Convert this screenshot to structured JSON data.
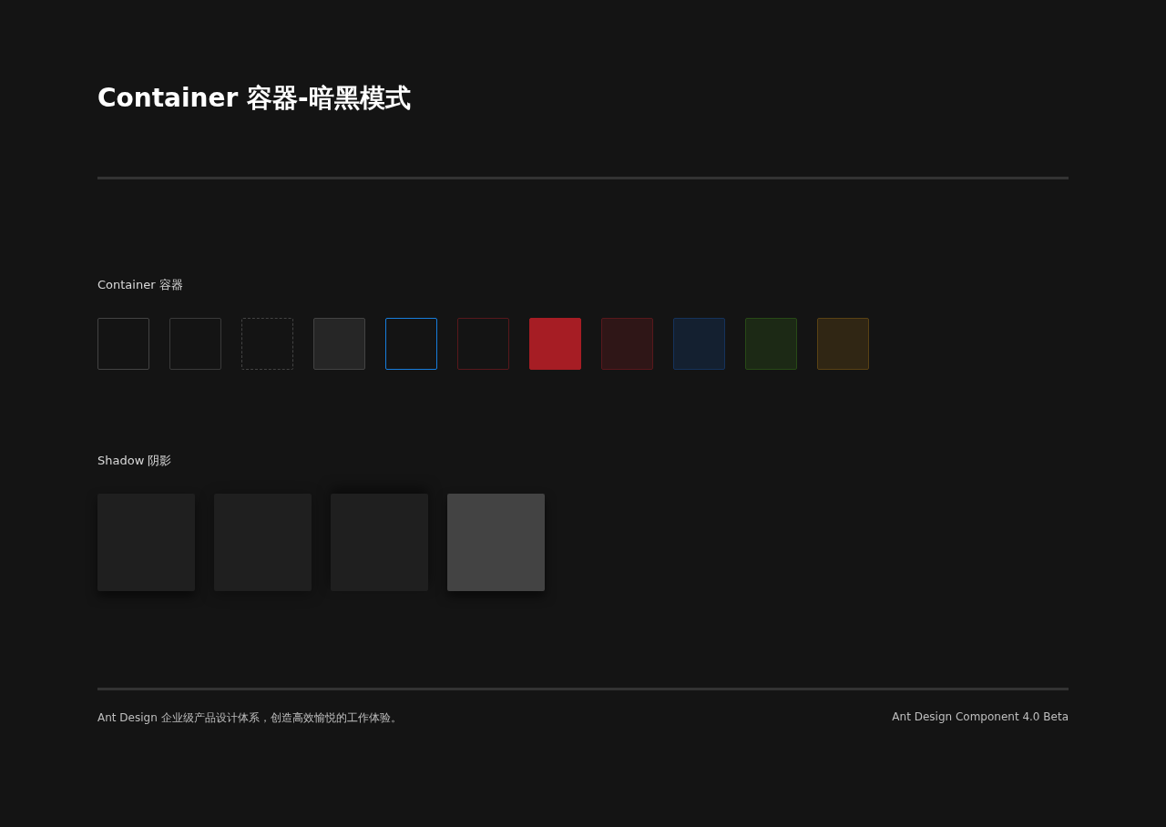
{
  "title": "Container 容器-暗黑模式",
  "container_section": {
    "heading": "Container 容器",
    "swatches": [
      {
        "kind": "outlined",
        "color": "#434343"
      },
      {
        "kind": "outlined",
        "color": "#3a3a3a"
      },
      {
        "kind": "dashed",
        "color": "#434343"
      },
      {
        "kind": "filled",
        "color": "#262626"
      },
      {
        "kind": "outlined",
        "color": "#177ddc"
      },
      {
        "kind": "outlined",
        "color": "#58181c"
      },
      {
        "kind": "filled",
        "color": "#a61d24"
      },
      {
        "kind": "tinted",
        "color": "#58181c"
      },
      {
        "kind": "tinted",
        "color": "#15325b"
      },
      {
        "kind": "tinted",
        "color": "#274916"
      },
      {
        "kind": "tinted",
        "color": "#594214"
      }
    ]
  },
  "shadow_section": {
    "heading": "Shadow 阴影",
    "cards": [
      {
        "kind": "down",
        "color": "#1f1f1f"
      },
      {
        "kind": "soft",
        "color": "#1f1f1f"
      },
      {
        "kind": "up",
        "color": "#1f1f1f"
      },
      {
        "kind": "down",
        "color": "#434343"
      }
    ]
  },
  "footer": {
    "left": "Ant Design 企业级产品设计体系，创造高效愉悦的工作体验。",
    "right": "Ant Design Component 4.0 Beta"
  }
}
